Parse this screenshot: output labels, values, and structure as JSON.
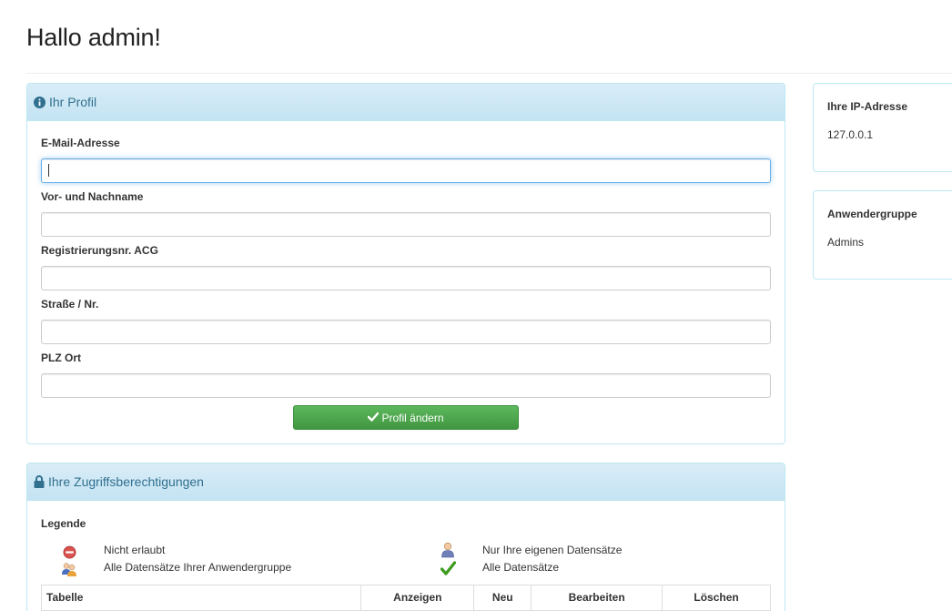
{
  "header": {
    "title": "Hallo admin!"
  },
  "profile": {
    "heading": "Ihr Profil",
    "fields": [
      {
        "label": "E-Mail-Adresse",
        "value": ""
      },
      {
        "label": "Vor- und Nachname",
        "value": ""
      },
      {
        "label": "Registrierungsnr. ACG",
        "value": ""
      },
      {
        "label": "Straße / Nr.",
        "value": ""
      },
      {
        "label": "PLZ Ort",
        "value": ""
      }
    ],
    "submit_label": "Profil ändern"
  },
  "ip": {
    "title": "Ihre IP-Adresse",
    "value": "127.0.0.1"
  },
  "group": {
    "title": "Anwendergruppe",
    "value": "Admins"
  },
  "access": {
    "heading": "Ihre Zugriffsberechtigungen",
    "legend_title": "Legende",
    "legend": [
      {
        "icon": "no-entry-icon",
        "label": "Nicht erlaubt"
      },
      {
        "icon": "single-user-icon",
        "label": "Nur Ihre eigenen Datensätze"
      },
      {
        "icon": "user-group-icon",
        "label": "Alle Datensätze Ihrer Anwendergruppe"
      },
      {
        "icon": "checkmark-icon",
        "label": "Alle Datensätze"
      }
    ],
    "columns": [
      "Tabelle",
      "Anzeigen",
      "Neu",
      "Bearbeiten",
      "Löschen"
    ]
  },
  "colors": {
    "panel_border": "#bce8f1",
    "panel_heading_text": "#31708f",
    "button_green": "#5cb85c",
    "no_entry_red": "#d9534f",
    "check_green": "#3c9a1e"
  }
}
